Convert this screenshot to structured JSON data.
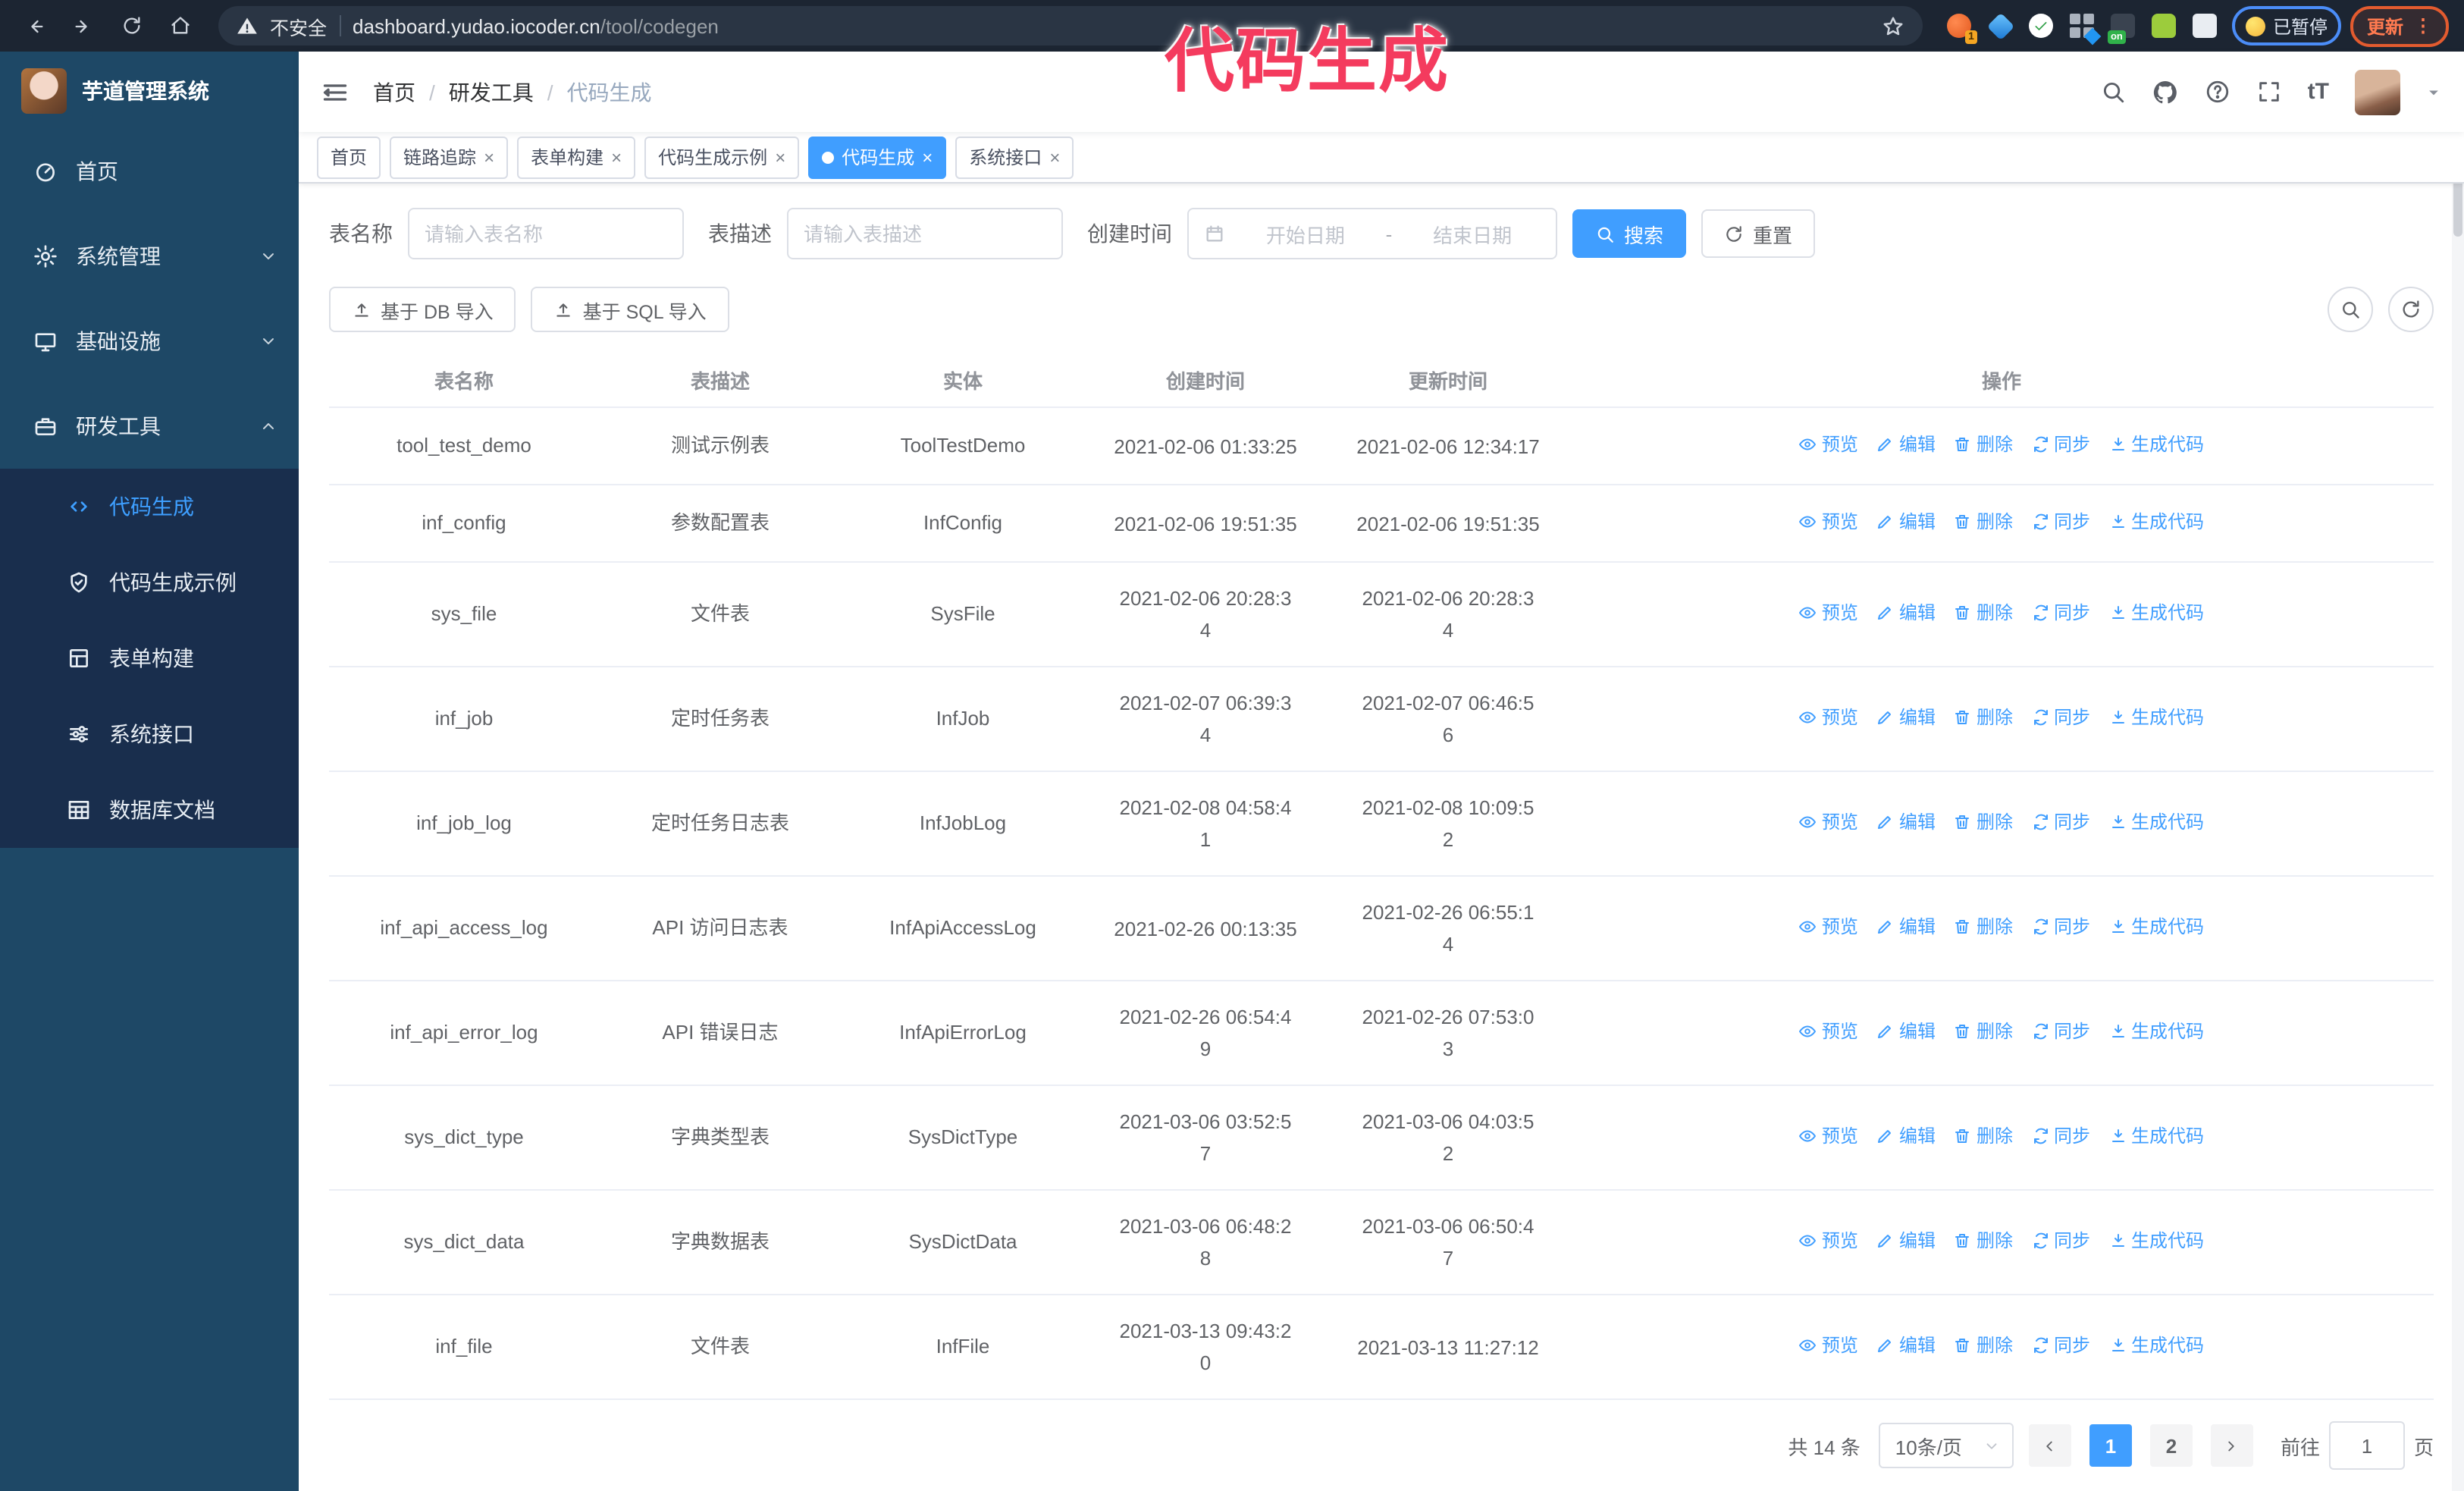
{
  "browser": {
    "secure_warning": "不安全",
    "url_host": "dashboard.yudao.iocoder.cn",
    "url_path": "/tool/codegen",
    "ext_badge_count": "1",
    "ext_badge_on": "on",
    "paused_label": "已暂停",
    "update_label": "更新",
    "menu_dots": "⋮"
  },
  "annotation": {
    "text": "代码生成",
    "color": "#f43b5e"
  },
  "sidebar": {
    "app_title": "芋道管理系统",
    "items": [
      {
        "label": "首页"
      },
      {
        "label": "系统管理"
      },
      {
        "label": "基础设施"
      },
      {
        "label": "研发工具"
      }
    ],
    "submenu": [
      {
        "label": "代码生成"
      },
      {
        "label": "代码生成示例"
      },
      {
        "label": "表单构建"
      },
      {
        "label": "系统接口"
      },
      {
        "label": "数据库文档"
      }
    ]
  },
  "navbar": {
    "breadcrumb": [
      "首页",
      "研发工具",
      "代码生成"
    ],
    "separator": "/",
    "font_size_icon": "tT"
  },
  "tags": {
    "close_glyph": "×",
    "items": [
      {
        "label": "首页"
      },
      {
        "label": "链路追踪"
      },
      {
        "label": "表单构建"
      },
      {
        "label": "代码生成示例"
      },
      {
        "label": "代码生成"
      },
      {
        "label": "系统接口"
      }
    ]
  },
  "search": {
    "name_label": "表名称",
    "name_placeholder": "请输入表名称",
    "desc_label": "表描述",
    "desc_placeholder": "请输入表描述",
    "time_label": "创建时间",
    "start_placeholder": "开始日期",
    "range_separator": "-",
    "end_placeholder": "结束日期",
    "search_button": "搜索",
    "reset_button": "重置"
  },
  "import_toolbar": {
    "db_button": "基于 DB 导入",
    "sql_button": "基于 SQL 导入"
  },
  "table": {
    "columns": [
      "表名称",
      "表描述",
      "实体",
      "创建时间",
      "更新时间",
      "操作"
    ],
    "action_labels": [
      "预览",
      "编辑",
      "删除",
      "同步",
      "生成代码"
    ],
    "rows": [
      {
        "name": "tool_test_demo",
        "desc": "测试示例表",
        "entity": "ToolTestDemo",
        "created": "2021-02-06 01:33:25",
        "updated": "2021-02-06 12:34:17"
      },
      {
        "name": "inf_config",
        "desc": "参数配置表",
        "entity": "InfConfig",
        "created": "2021-02-06 19:51:35",
        "updated": "2021-02-06 19:51:35"
      },
      {
        "name": "sys_file",
        "desc": "文件表",
        "entity": "SysFile",
        "created": "2021-02-06 20:28:3\n4",
        "updated": "2021-02-06 20:28:3\n4"
      },
      {
        "name": "inf_job",
        "desc": "定时任务表",
        "entity": "InfJob",
        "created": "2021-02-07 06:39:3\n4",
        "updated": "2021-02-07 06:46:5\n6"
      },
      {
        "name": "inf_job_log",
        "desc": "定时任务日志表",
        "entity": "InfJobLog",
        "created": "2021-02-08 04:58:4\n1",
        "updated": "2021-02-08 10:09:5\n2"
      },
      {
        "name": "inf_api_access_log",
        "desc": "API 访问日志表",
        "entity": "InfApiAccessLog",
        "created": "2021-02-26 00:13:35",
        "updated": "2021-02-26 06:55:1\n4"
      },
      {
        "name": "inf_api_error_log",
        "desc": "API 错误日志",
        "entity": "InfApiErrorLog",
        "created": "2021-02-26 06:54:4\n9",
        "updated": "2021-02-26 07:53:0\n3"
      },
      {
        "name": "sys_dict_type",
        "desc": "字典类型表",
        "entity": "SysDictType",
        "created": "2021-03-06 03:52:5\n7",
        "updated": "2021-03-06 04:03:5\n2"
      },
      {
        "name": "sys_dict_data",
        "desc": "字典数据表",
        "entity": "SysDictData",
        "created": "2021-03-06 06:48:2\n8",
        "updated": "2021-03-06 06:50:4\n7"
      },
      {
        "name": "inf_file",
        "desc": "文件表",
        "entity": "InfFile",
        "created": "2021-03-13 09:43:2\n0",
        "updated": "2021-03-13 11:27:12"
      }
    ]
  },
  "pagination": {
    "total": "共 14 条",
    "page_size": "10条/页",
    "pages": [
      "1",
      "2"
    ],
    "active_page": "1",
    "goto_label": "前往",
    "goto_value": "1",
    "goto_suffix": "页"
  },
  "colors": {
    "primary": "#409eff",
    "sidebar_bg": "#1e4866",
    "submenu_bg": "#192e4d",
    "browser_bar_bg": "#1c2532",
    "annotation": "#f43b5e"
  }
}
